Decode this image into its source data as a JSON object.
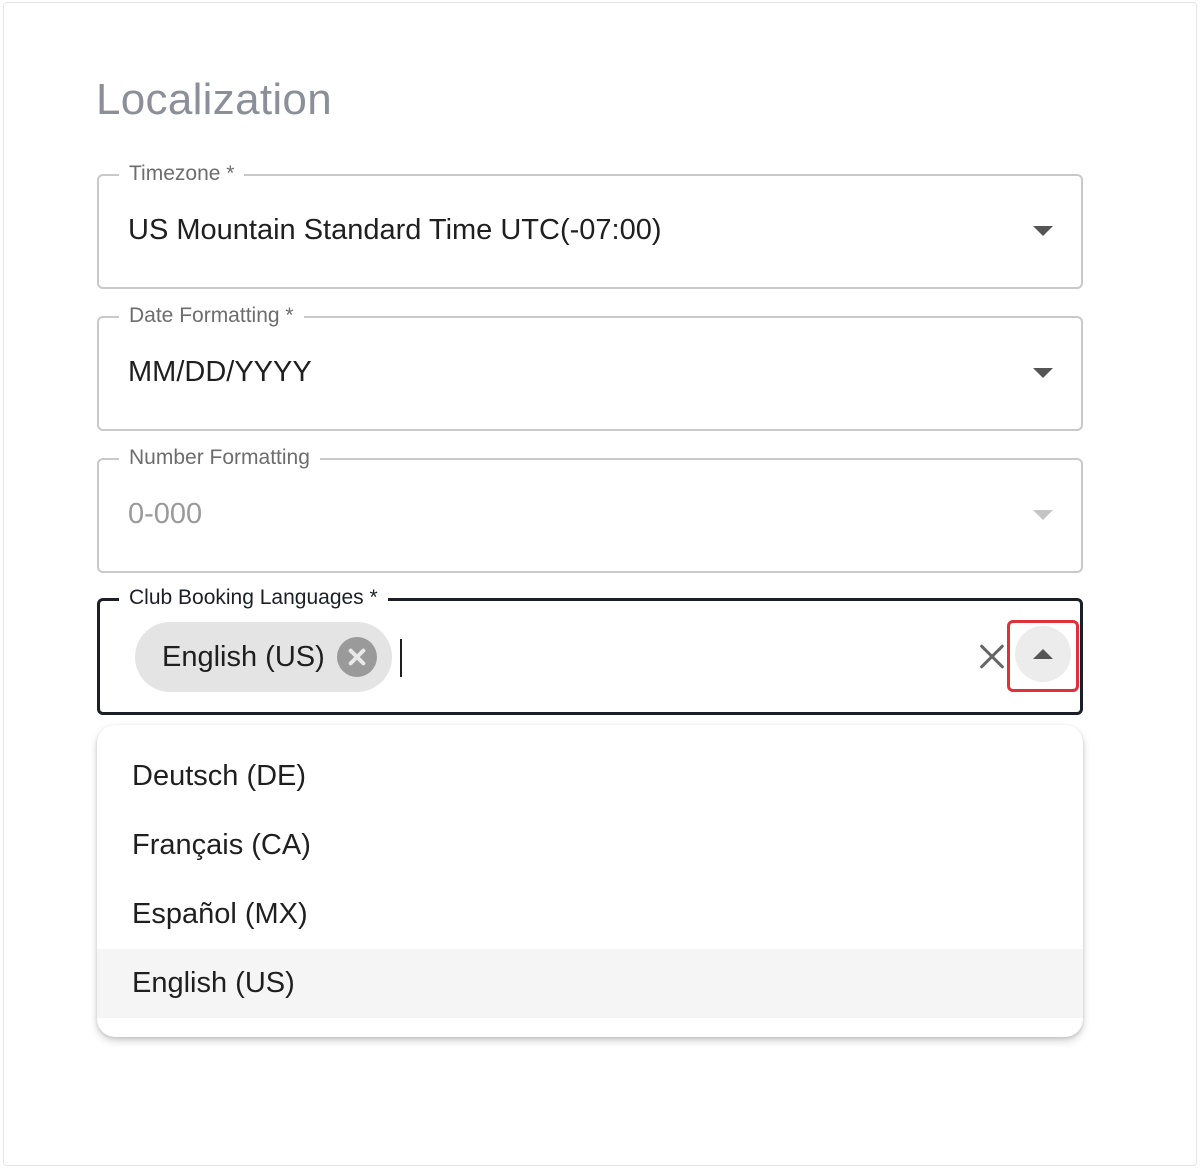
{
  "page": {
    "title": "Localization"
  },
  "fields": {
    "timezone": {
      "label": "Timezone *",
      "value": "US Mountain Standard Time UTC(-07:00)"
    },
    "date_formatting": {
      "label": "Date Formatting *",
      "value": "MM/DD/YYYY"
    },
    "number_formatting": {
      "label": "Number Formatting",
      "value": "0-000",
      "disabled": true
    },
    "club_booking_languages": {
      "label": "Club Booking Languages *",
      "selected_chip": "English (US)"
    }
  },
  "menu": {
    "options": [
      "Deutsch (DE)",
      "Français (CA)",
      "Español (MX)",
      "English (US)"
    ],
    "highlighted": "English (US)"
  },
  "colors": {
    "title": "#8a8f99",
    "focus_border": "#1d1f27",
    "highlight_box": "#e0313b",
    "chip_bg": "#e4e4e4"
  }
}
